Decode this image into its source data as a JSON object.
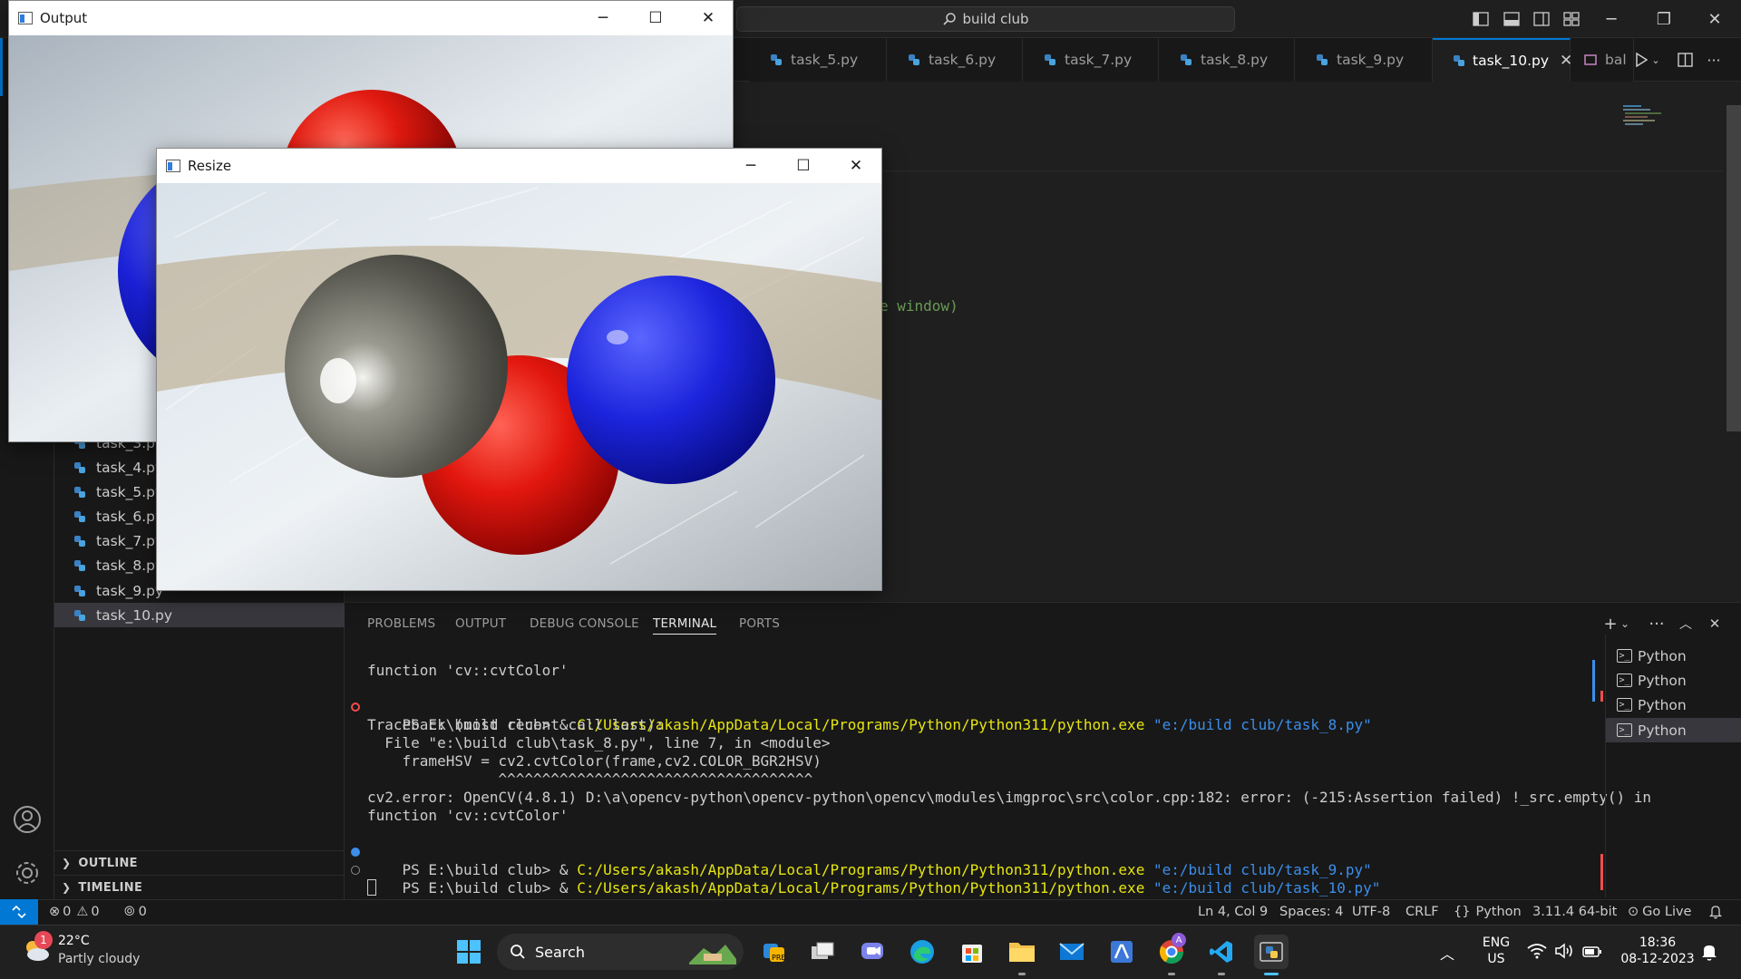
{
  "titlebar": {
    "search_text": "build club"
  },
  "sidebar": {
    "partial_top_item": "task_3.py",
    "files": [
      "task_4.py",
      "task_5.py",
      "task_6.py",
      "task_7.py",
      "task_8.py",
      "task_9.py",
      "task_10.py"
    ],
    "active_file": "task_10.py",
    "outline_label": "OUTLINE",
    "timeline_label": "TIMELINE"
  },
  "tabs": {
    "items": [
      "task_5.py",
      "task_6.py",
      "task_7.py",
      "task_8.py",
      "task_9.py",
      "task_10.py"
    ],
    "active": "task_10.py",
    "extra_label": "bal"
  },
  "editor": {
    "code_fragment": "e window)"
  },
  "panel": {
    "tabs": [
      "PROBLEMS",
      "OUTPUT",
      "DEBUG CONSOLE",
      "TERMINAL",
      "PORTS"
    ],
    "active_tab": "TERMINAL",
    "terminals": [
      "Python",
      "Python",
      "Python",
      "Python"
    ]
  },
  "terminal": {
    "line1": "function 'cv::cvtColor'",
    "prompt_prefix": "PS E:\\build club> & ",
    "python_exe": "C:/Users/akash/AppData/Local/Programs/Python/Python311/python.exe",
    "script_8": "\"e:/build club/task_8.py\"",
    "traceback_head": "Traceback (most recent call last):",
    "traceback_file": "  File \"e:\\build club\\task_8.py\", line 7, in <module>",
    "traceback_code": "    frameHSV = cv2.cvtColor(frame,cv2.COLOR_BGR2HSV)",
    "traceback_caret": "               ^^^^^^^^^^^^^^^^^^^^^^^^^^^^^^^^^^^^",
    "error_line": "cv2.error: OpenCV(4.8.1) D:\\a\\opencv-python\\opencv-python\\opencv\\modules\\imgproc\\src\\color.cpp:182: error: (-215:Assertion failed) !_src.empty() in",
    "error_line2": "function 'cv::cvtColor'",
    "script_9": "\"e:/build club/task_9.py\"",
    "script_10": "\"e:/build club/task_10.py\""
  },
  "statusbar": {
    "errors": "0",
    "warnings": "0",
    "ports": "0",
    "position": "Ln 4, Col 9",
    "spaces": "Spaces: 4",
    "encoding": "UTF-8",
    "eol": "CRLF",
    "language": "Python",
    "interpreter": "3.11.4 64-bit",
    "golive": "Go Live"
  },
  "windows": {
    "output_title": "Output",
    "resize_title": "Resize"
  },
  "taskbar": {
    "weather_temp": "22°C",
    "weather_desc": "Partly cloudy",
    "weather_badge": "1",
    "search_label": "Search",
    "lang_line1": "ENG",
    "lang_line2": "US",
    "time": "18:36",
    "date": "08-12-2023"
  },
  "colors": {
    "accent": "#0078d4",
    "terminal_yellow": "#e5e510",
    "terminal_string": "#3b8eea",
    "error_dot": "#f14c4c",
    "info_dot": "#3b8eea"
  }
}
